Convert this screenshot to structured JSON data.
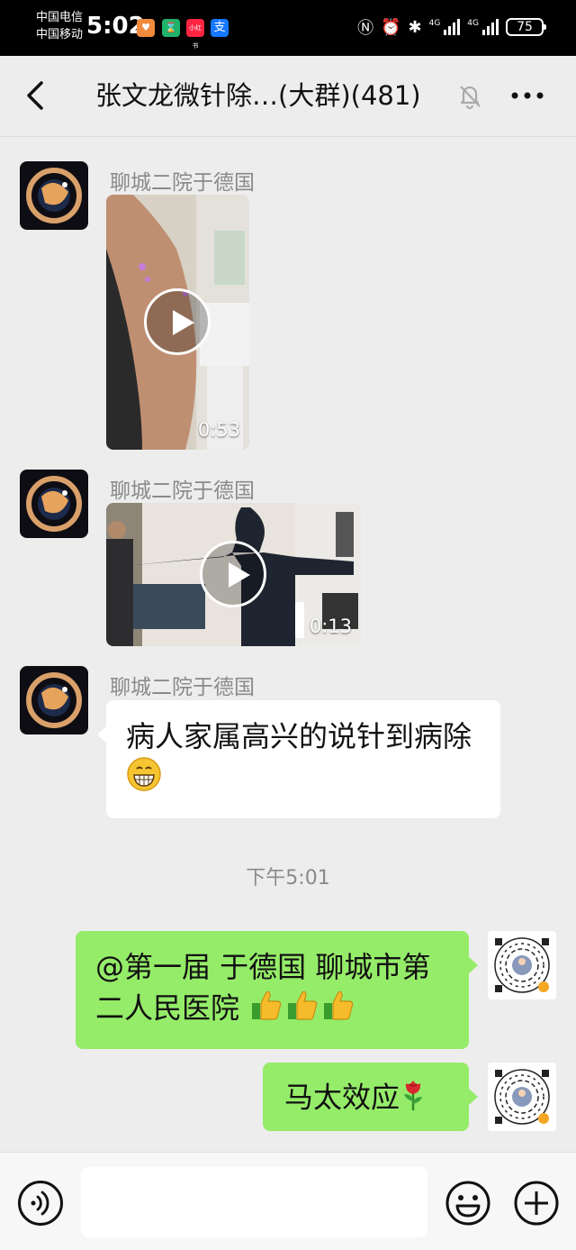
{
  "status_bar": {
    "carrier_1": "中国电信",
    "carrier_2": "中国移动",
    "time": "5:02",
    "network_1": "4G",
    "network_2": "4G",
    "battery": "75",
    "app_icon_3": "小红书",
    "app_icon_4": "支"
  },
  "header": {
    "title": "张文龙微针除…(大群)(481)"
  },
  "messages": [
    {
      "sender": "聊城二院于德国",
      "video_duration": "0:53"
    },
    {
      "sender": "聊城二院于德国",
      "video_duration": "0:13"
    },
    {
      "sender": "聊城二院于德国",
      "text": "病人家属高兴的说针到病除"
    },
    {
      "text": "@第一届 于德国 聊城市第二人民医院"
    },
    {
      "text": "马太效应"
    }
  ],
  "timestamp": "下午5:01",
  "icons": {
    "back": "back-arrow-icon",
    "mute": "bell-mute-icon",
    "more": "more-dots-icon",
    "voice": "voice-icon",
    "emoji": "emoji-smile-icon",
    "plus": "plus-icon"
  },
  "colors": {
    "background": "#ededed",
    "outgoing_bubble": "#95ec69",
    "incoming_bubble": "#ffffff",
    "secondary_text": "#8a8a8a"
  }
}
